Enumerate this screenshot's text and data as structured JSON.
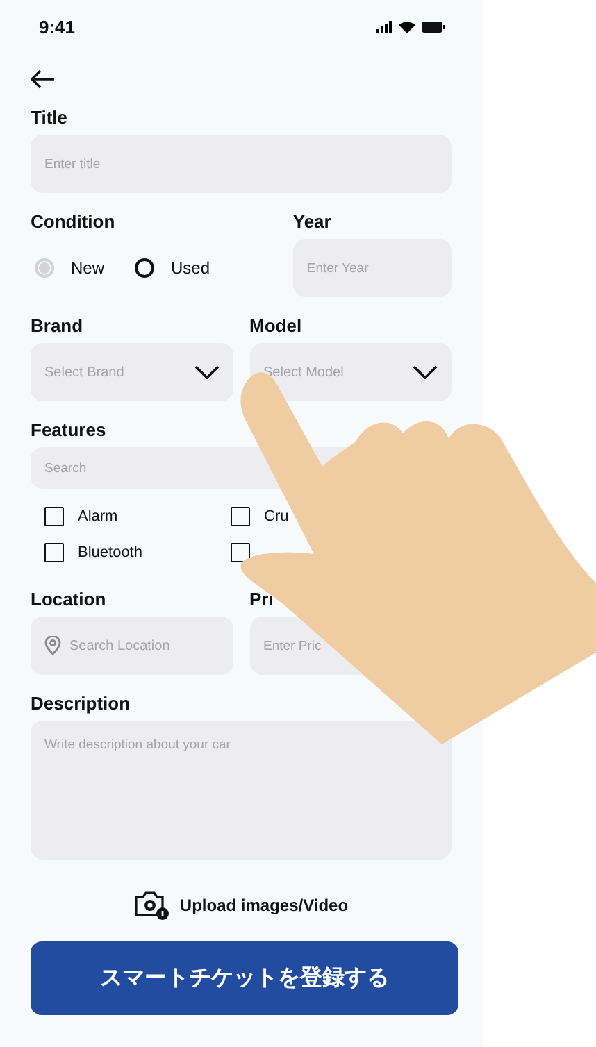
{
  "status_bar": {
    "time": "9:41"
  },
  "title_field": {
    "label": "Title",
    "placeholder": "Enter title"
  },
  "condition": {
    "label": "Condition",
    "options": [
      {
        "label": "New",
        "selected": true
      },
      {
        "label": "Used",
        "selected": false
      }
    ]
  },
  "year_field": {
    "label": "Year",
    "placeholder": "Enter Year"
  },
  "brand_field": {
    "label": "Brand",
    "placeholder": "Select Brand"
  },
  "model_field": {
    "label": "Model",
    "placeholder": "Select Model"
  },
  "features": {
    "label": "Features",
    "search_placeholder": "Search",
    "items": [
      {
        "label": "Alarm",
        "checked": false
      },
      {
        "label": "Cru",
        "checked": false
      },
      {
        "label": "Bluetooth",
        "checked": false
      },
      {
        "checked": false
      }
    ]
  },
  "location_field": {
    "label": "Location",
    "placeholder": "Search Location"
  },
  "price_field": {
    "label": "Pri",
    "placeholder": "Enter Pric"
  },
  "description_field": {
    "label": "Description",
    "placeholder": "Write description about your car"
  },
  "upload": {
    "label": "Upload images/Video"
  },
  "submit_button": {
    "label": "スマートチケットを登録する"
  }
}
